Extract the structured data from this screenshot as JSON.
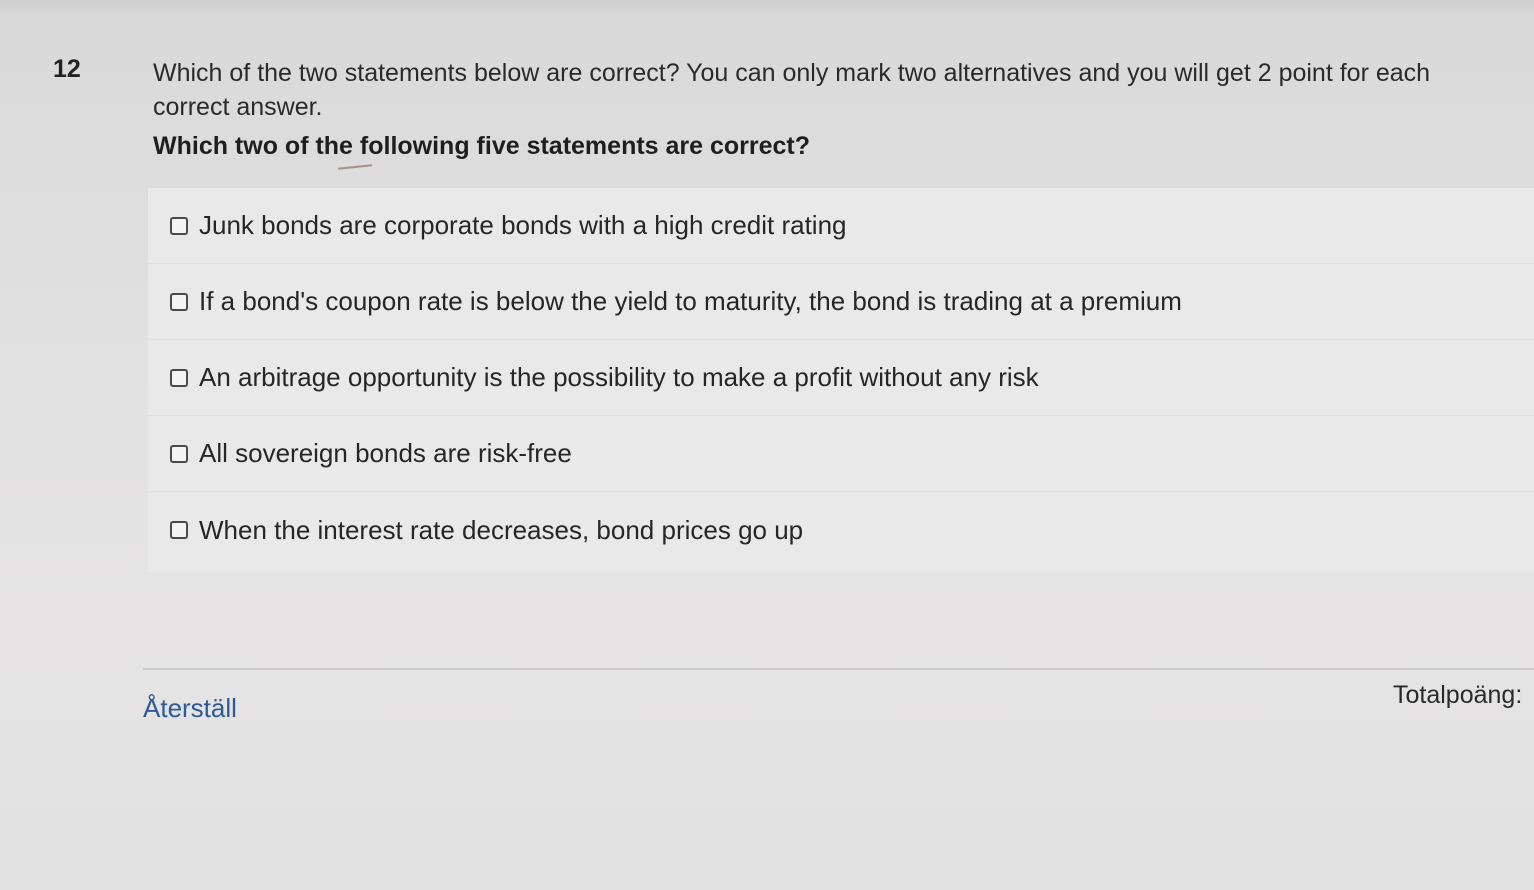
{
  "question": {
    "number": "12",
    "instructions": "Which of the two statements below are correct? You can only mark two alternatives and you will get 2 point for each correct answer.",
    "prompt": "Which two of the following five statements are correct?",
    "options": [
      {
        "label": "Junk bonds are corporate bonds with a high credit rating",
        "checked": false
      },
      {
        "label": "If a bond's coupon rate is below the yield to maturity, the bond is trading at a premium",
        "checked": false
      },
      {
        "label": "An arbitrage opportunity is the possibility to make a profit without any risk",
        "checked": false
      },
      {
        "label": "All sovereign bonds are risk-free",
        "checked": false
      },
      {
        "label": "When the interest rate decreases, bond prices go up",
        "checked": false
      }
    ]
  },
  "footer": {
    "reset_label": "Återställ",
    "total_label": "Totalpoäng:"
  },
  "colors": {
    "link": "#2d5a94",
    "background": "#e1e1e1",
    "option_background": "#e9e9e9"
  }
}
